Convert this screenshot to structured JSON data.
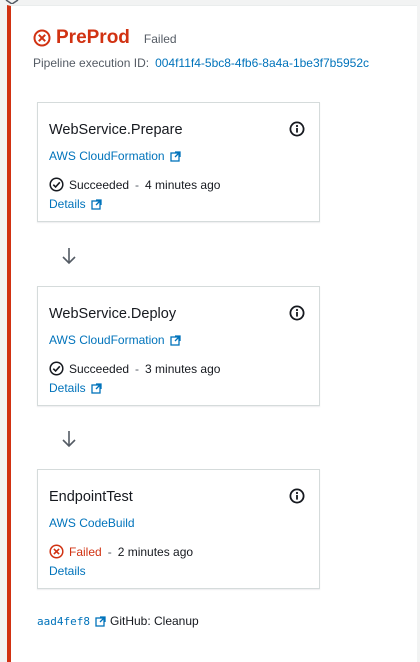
{
  "stage": {
    "name": "PreProd",
    "status": "Failed",
    "execution_label": "Pipeline execution ID:",
    "execution_id": "004f11f4-5bc8-4fb6-8a4a-1be3f7b5952c",
    "status_color": "#d13212"
  },
  "actions": [
    {
      "name": "WebService.Prepare",
      "provider": "AWS CloudFormation",
      "status": "Succeeded",
      "time": "4 minutes ago",
      "details": "Details",
      "status_icon": "check-circle-icon"
    },
    {
      "name": "WebService.Deploy",
      "provider": "AWS CloudFormation",
      "status": "Succeeded",
      "time": "3 minutes ago",
      "details": "Details",
      "status_icon": "check-circle-icon"
    },
    {
      "name": "EndpointTest",
      "provider": "AWS CodeBuild",
      "status": "Failed",
      "time": "2 minutes ago",
      "details": "Details",
      "status_icon": "x-circle-icon"
    }
  ],
  "footer": {
    "commit": "aad4fef8",
    "message": "GitHub: Cleanup"
  },
  "colors": {
    "link": "#0073bb",
    "error": "#d13212",
    "text": "#16191f",
    "muted": "#545b64"
  }
}
